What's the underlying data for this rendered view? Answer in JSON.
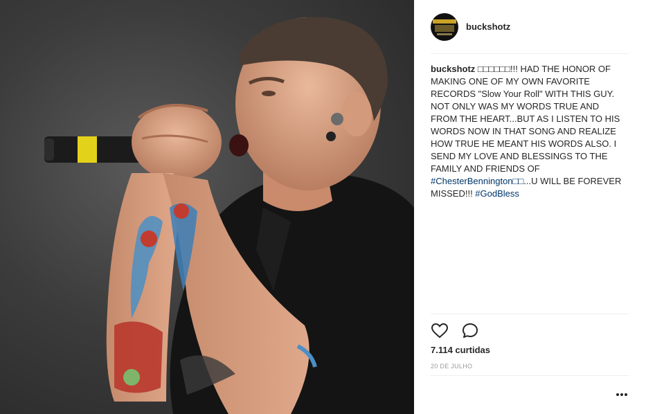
{
  "post": {
    "username": "buckshotz",
    "caption": {
      "username": "buckshotz",
      "emoji_placeholder": "□□□□□□",
      "text_1": "!!! HAD THE HONOR OF MAKING ONE OF MY OWN FAVORITE RECORDS \"Slow Your Roll\" WITH THIS GUY. NOT ONLY WAS MY WORDS TRUE AND FROM THE HEART...BUT AS I LISTEN TO HIS WORDS NOW IN THAT SONG AND REALIZE HOW TRUE HE MEANT HIS WORDS ALSO. I SEND MY LOVE AND BLESSINGS TO THE FAMILY AND FRIENDS OF ",
      "hashtag_1": "#ChesterBennington□□",
      "text_2": "...U WILL BE FOREVER MISSED!!! ",
      "hashtag_2": "#GodBless"
    },
    "likes": "7.114 curtidas",
    "date": "20 DE JULHO"
  },
  "icons": {
    "like": "heart-outline-icon",
    "comment": "speech-bubble-icon",
    "more": "ellipsis-icon"
  },
  "colors": {
    "hashtag": "#003569",
    "text": "#262626",
    "muted": "#999999",
    "divider": "#efefef"
  }
}
